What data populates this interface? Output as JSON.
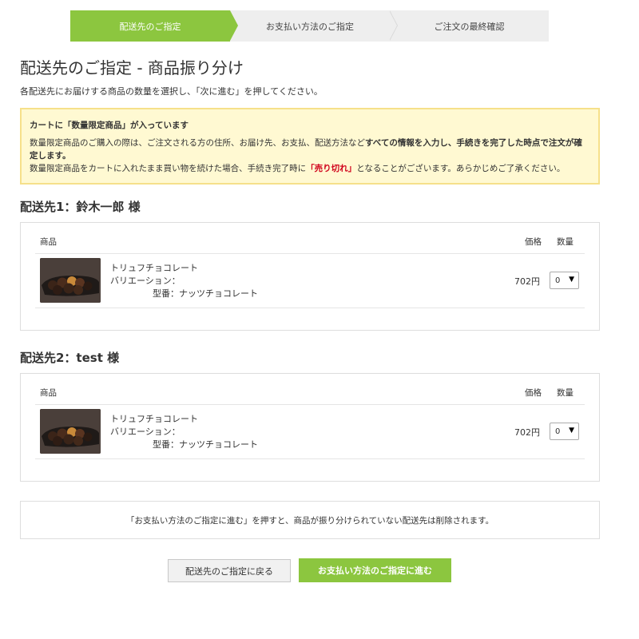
{
  "steps": [
    {
      "label": "配送先のご指定"
    },
    {
      "label": "お支払い方法のご指定"
    },
    {
      "label": "ご注文の最終確認"
    }
  ],
  "page_title": "配送先のご指定 - 商品振り分け",
  "intro": "各配送先にお届けする商品の数量を選択し、「次に進む」を押してください。",
  "notice": {
    "heading": "カートに「数量限定商品」が入っています",
    "line1_pre": "数量限定商品のご購入の際は、ご注文される方の住所、お届け先、お支払、配送方法など",
    "line1_bold": "すべての情報を入力し、手続きを完了した時点で注文が確定します。",
    "line2_pre": "数量限定商品をカートに入れたまま買い物を続けた場合、手続き完了時に",
    "line2_red": "「売り切れ」",
    "line2_post": "となることがございます。あらかじめご了承ください。",
    "bg_color": "#fff9d2",
    "border_color": "#f6e08a"
  },
  "shipments": [
    {
      "title": "配送先1：鈴木一郎 様",
      "headers": {
        "product": "商品",
        "price": "価格",
        "qty": "数量"
      },
      "item": {
        "name": "トリュフチョコレート",
        "variation": "バリエーション：",
        "sku": "型番：ナッツチョコレート",
        "price": "702円",
        "qty": "0"
      }
    },
    {
      "title": "配送先2：test 様",
      "headers": {
        "product": "商品",
        "price": "価格",
        "qty": "数量"
      },
      "item": {
        "name": "トリュフチョコレート",
        "variation": "バリエーション：",
        "sku": "型番：ナッツチョコレート",
        "price": "702円",
        "qty": "0"
      }
    }
  ],
  "footer_note": "「お支払い方法のご指定に進む」を押すと、商品が振り分けられていない配送先は削除されます。",
  "buttons": {
    "back": "配送先のご指定に戻る",
    "next": "お支払い方法のご指定に進む"
  },
  "colors": {
    "accent": "#8cc63f",
    "step_inactive": "#eeeeee",
    "alert_red": "#d0021b"
  },
  "icons": {
    "select_arrow": "▼"
  }
}
